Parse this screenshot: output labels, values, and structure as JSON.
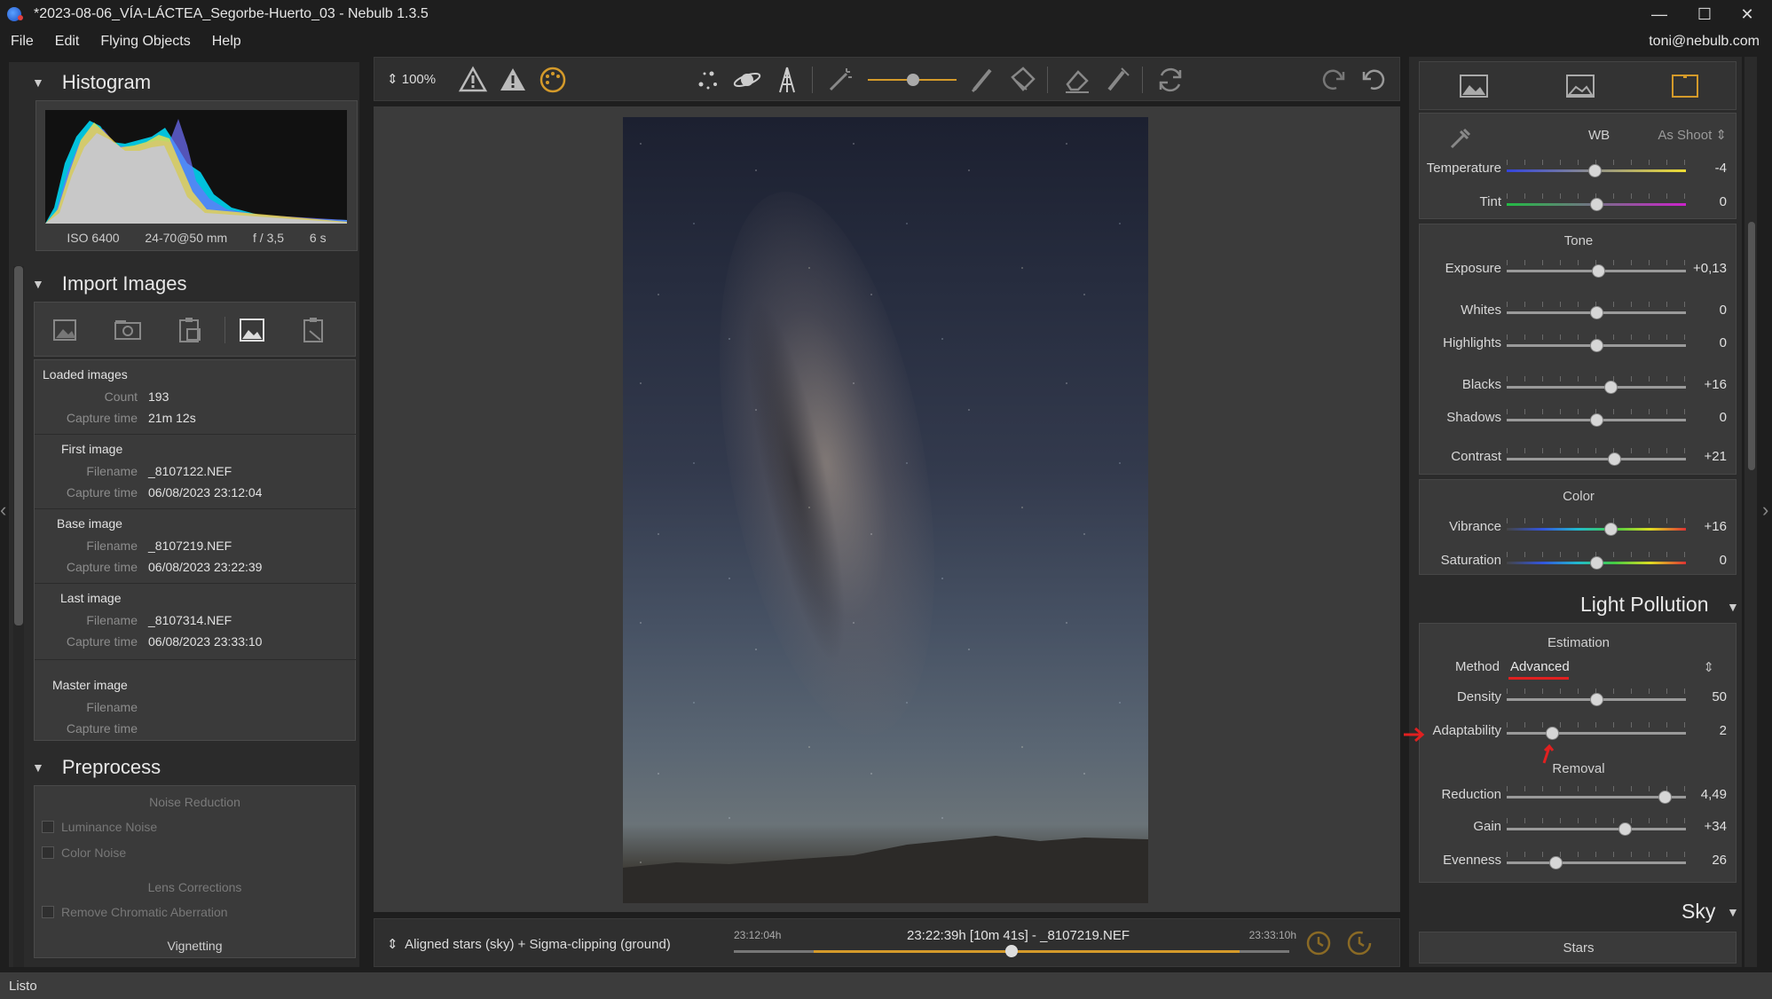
{
  "window": {
    "title": "*2023-08-06_VÍA-LÁCTEA_Segorbe-Huerto_03 - Nebulb 1.3.5",
    "min": "—",
    "max": "☐",
    "close": "✕"
  },
  "menu": {
    "items": [
      "File",
      "Edit",
      "Flying Objects",
      "Help"
    ],
    "user": "toni@nebulb.com"
  },
  "status": "Listo",
  "left": {
    "histogram": {
      "title": "Histogram",
      "iso": "ISO 6400",
      "lens": "24-70@50 mm",
      "aperture": "f / 3,5",
      "shutter": "6 s"
    },
    "import": {
      "title": "Import Images",
      "loaded": {
        "title": "Loaded images",
        "count_label": "Count",
        "count": "193",
        "time_label": "Capture time",
        "time": "21m 12s"
      },
      "first": {
        "title": "First image",
        "file_label": "Filename",
        "file": "_8107122.NEF",
        "time_label": "Capture time",
        "time": "06/08/2023 23:12:04"
      },
      "base": {
        "title": "Base image",
        "file_label": "Filename",
        "file": "_8107219.NEF",
        "time_label": "Capture time",
        "time": "06/08/2023 23:22:39"
      },
      "last": {
        "title": "Last image",
        "file_label": "Filename",
        "file": "_8107314.NEF",
        "time_label": "Capture time",
        "time": "06/08/2023 23:33:10"
      },
      "master": {
        "title": "Master image",
        "file_label": "Filename",
        "time_label": "Capture time"
      }
    },
    "preprocess": {
      "title": "Preprocess",
      "noise_title": "Noise Reduction",
      "luminance": "Luminance Noise",
      "color": "Color Noise",
      "lens_title": "Lens Corrections",
      "chromatic": "Remove Chromatic Aberration",
      "vignetting": "Vignetting"
    }
  },
  "toolbar": {
    "zoom": "100%"
  },
  "timeline": {
    "method": "Aligned stars (sky) + Sigma-clipping (ground)",
    "start": "23:12:04h",
    "end": "23:33:10h",
    "current": "23:22:39h [10m 41s] - _8107219.NEF",
    "position": 0.5
  },
  "right": {
    "wb": {
      "label": "WB",
      "mode": "As Shoot"
    },
    "temperature": {
      "label": "Temperature",
      "value": "-4",
      "pos": 0.49
    },
    "tint": {
      "label": "Tint",
      "value": "0",
      "pos": 0.5
    },
    "tone_title": "Tone",
    "exposure": {
      "label": "Exposure",
      "value": "+0,13",
      "pos": 0.51
    },
    "whites": {
      "label": "Whites",
      "value": "0",
      "pos": 0.5
    },
    "highlights": {
      "label": "Highlights",
      "value": "0",
      "pos": 0.5
    },
    "blacks": {
      "label": "Blacks",
      "value": "+16",
      "pos": 0.58
    },
    "shadows": {
      "label": "Shadows",
      "value": "0",
      "pos": 0.5
    },
    "contrast": {
      "label": "Contrast",
      "value": "+21",
      "pos": 0.6
    },
    "color_title": "Color",
    "vibrance": {
      "label": "Vibrance",
      "value": "+16",
      "pos": 0.58
    },
    "saturation": {
      "label": "Saturation",
      "value": "0",
      "pos": 0.5
    },
    "lp_title": "Light Pollution",
    "estimation_title": "Estimation",
    "method": {
      "label": "Method",
      "value": "Advanced"
    },
    "density": {
      "label": "Density",
      "value": "50",
      "pos": 0.5
    },
    "adaptability": {
      "label": "Adaptability",
      "value": "2",
      "pos": 0.25
    },
    "removal_title": "Removal",
    "reduction": {
      "label": "Reduction",
      "value": "4,49",
      "pos": 0.88
    },
    "gain": {
      "label": "Gain",
      "value": "+34",
      "pos": 0.66
    },
    "evenness": {
      "label": "Evenness",
      "value": "26",
      "pos": 0.27
    },
    "sky_title": "Sky",
    "stars_title": "Stars"
  },
  "colors": {
    "accent": "#d49a2a",
    "annotation": "#e02020"
  }
}
